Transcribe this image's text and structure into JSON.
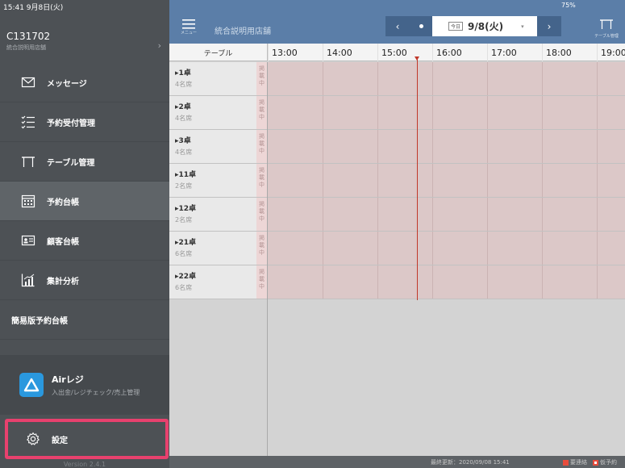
{
  "status_bar": {
    "time": "15:41  9月8日(火)",
    "right": "75%"
  },
  "account": {
    "id": "C131702",
    "shop": "統合説明用店舗",
    "chevron": "›"
  },
  "sidebar": {
    "items": [
      {
        "label": "メッセージ",
        "icon": "envelope-icon"
      },
      {
        "label": "予約受付管理",
        "icon": "checklist-icon"
      },
      {
        "label": "テーブル管理",
        "icon": "table-icon"
      },
      {
        "label": "予約台帳",
        "icon": "calendar-icon",
        "active": true
      },
      {
        "label": "顧客台帳",
        "icon": "customer-card-icon"
      },
      {
        "label": "集計分析",
        "icon": "analytics-icon"
      },
      {
        "label": "簡易版予約台帳"
      }
    ],
    "airregi": {
      "title": "Airレジ",
      "subtitle": "入出金/レジチェック/売上管理",
      "icon": "airregi-logo-icon"
    },
    "settings": {
      "label": "設定",
      "icon": "gear-icon"
    },
    "version": "Version 2.4.1"
  },
  "header": {
    "menu_caption": "メニュー",
    "shop_name": "統合説明用店舗",
    "prev": "‹",
    "next": "›",
    "today_badge": "今日",
    "date": "9/8(火)",
    "caret": "▾",
    "table_caption": "テーブル管理"
  },
  "timeline": {
    "table_header": "テーブル",
    "hours": [
      "13:00",
      "14:00",
      "15:00",
      "16:00",
      "17:00",
      "18:00",
      "19:00"
    ],
    "rows": [
      {
        "name": "▸1卓",
        "seats": "4名席",
        "status": "掲載中"
      },
      {
        "name": "▸2卓",
        "seats": "4名席",
        "status": "掲載中"
      },
      {
        "name": "▸3卓",
        "seats": "4名席",
        "status": "掲載中"
      },
      {
        "name": "▸11卓",
        "seats": "2名席",
        "status": "掲載中"
      },
      {
        "name": "▸12卓",
        "seats": "2名席",
        "status": "掲載中"
      },
      {
        "name": "▸21卓",
        "seats": "6名席",
        "status": "掲載中"
      },
      {
        "name": "▸22卓",
        "seats": "6名席",
        "status": "掲載中"
      }
    ]
  },
  "footer": {
    "last_update": "最終更新：2020/09/08 15:41",
    "legend": [
      {
        "label": "要連絡",
        "color": "#e74c3c"
      },
      {
        "label": "仮予約",
        "color": "#e74c3c"
      }
    ]
  }
}
